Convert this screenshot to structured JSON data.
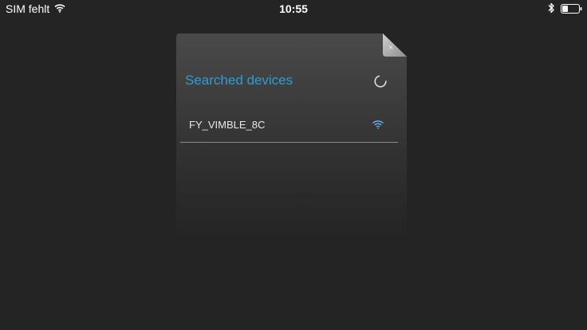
{
  "status_bar": {
    "carrier": "SIM fehlt",
    "time": "10:55",
    "battery_level": 0.35
  },
  "dialog": {
    "title": "Searched devices",
    "close_label": "×",
    "devices": [
      {
        "name": "FY_VIMBLE_8C"
      }
    ]
  },
  "colors": {
    "background": "#242424",
    "accent": "#2a9fd6",
    "text": "#e8e8e8"
  },
  "icons": {
    "status_wifi": "wifi-icon",
    "bluetooth": "bluetooth-icon",
    "battery": "battery-icon",
    "loading": "spinner-icon",
    "device_signal": "wifi-signal-icon"
  }
}
